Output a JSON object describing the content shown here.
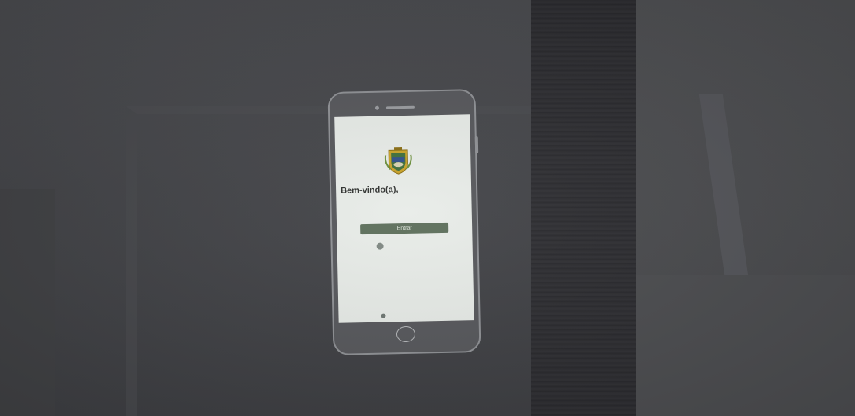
{
  "app": {
    "welcome_text": "Bem-vindo(a),",
    "enter_button": "Entrar",
    "radio_label": "",
    "link_text": ""
  },
  "logo": {
    "name": "crest-logo-icon",
    "accent": "#c9a227",
    "secondary": "#3f6e3a"
  },
  "colors": {
    "screen_bg": "#e8ece8",
    "button_bg": "#5c6e5a",
    "phone_body": "#56575b",
    "room_bg": "#45464a"
  }
}
